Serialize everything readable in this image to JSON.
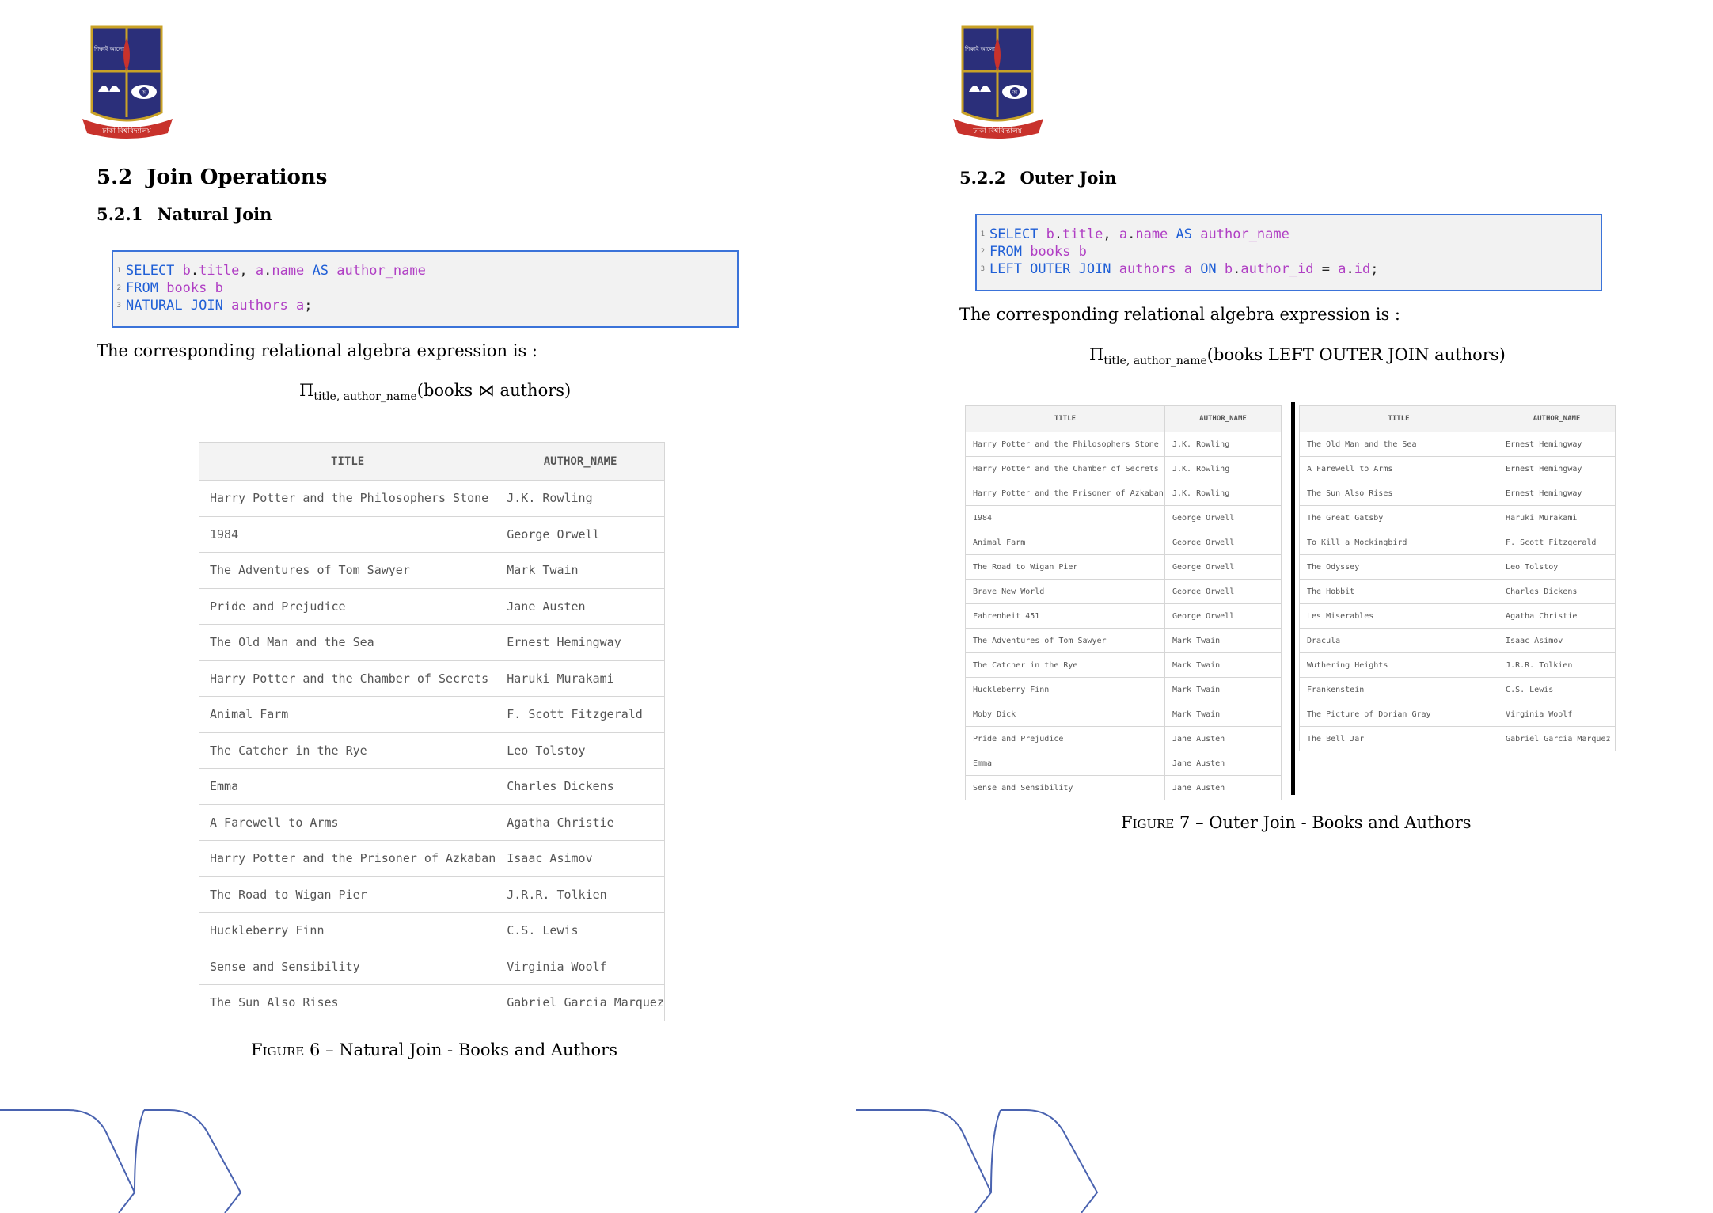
{
  "left_page": {
    "section": {
      "number": "5.2",
      "title": "Join Operations"
    },
    "subsection": {
      "number": "5.2.1",
      "title": "Natural Join"
    },
    "code": {
      "line_numbers": [
        "1",
        "2",
        "3"
      ],
      "line1": {
        "kw": "SELECT",
        "b": "b",
        "dot1": ".",
        "title": "title",
        "comma": ", ",
        "a": "a",
        "dot2": ".",
        "name": "name",
        "as": "AS",
        "alias": "author_name"
      },
      "line2": {
        "kw": "FROM",
        "table": "books",
        "alias": "b"
      },
      "line3": {
        "kw": "NATURAL JOIN",
        "table": "authors",
        "alias": "a",
        "semi": ";"
      }
    },
    "para": "The corresponding relational algebra expression is :",
    "expr": {
      "pi": "Π",
      "sub": "title, author_name",
      "body": "(books ⋈ authors)"
    },
    "table": {
      "headers": [
        "TITLE",
        "AUTHOR_NAME"
      ],
      "rows": [
        [
          "Harry Potter and the Philosophers Stone",
          "J.K. Rowling"
        ],
        [
          "1984",
          "George Orwell"
        ],
        [
          "The Adventures of Tom Sawyer",
          "Mark Twain"
        ],
        [
          "Pride and Prejudice",
          "Jane Austen"
        ],
        [
          "The Old Man and the Sea",
          "Ernest Hemingway"
        ],
        [
          "Harry Potter and the Chamber of Secrets",
          "Haruki Murakami"
        ],
        [
          "Animal Farm",
          "F. Scott Fitzgerald"
        ],
        [
          "The Catcher in the Rye",
          "Leo Tolstoy"
        ],
        [
          "Emma",
          "Charles Dickens"
        ],
        [
          "A Farewell to Arms",
          "Agatha Christie"
        ],
        [
          "Harry Potter and the Prisoner of Azkaban",
          "Isaac Asimov"
        ],
        [
          "The Road to Wigan Pier",
          "J.R.R. Tolkien"
        ],
        [
          "Huckleberry Finn",
          "C.S. Lewis"
        ],
        [
          "Sense and Sensibility",
          "Virginia Woolf"
        ],
        [
          "The Sun Also Rises",
          "Gabriel Garcia Marquez"
        ]
      ]
    },
    "caption": {
      "label": "Figure 6",
      "sep": " – ",
      "text": "Natural Join - Books and Authors"
    }
  },
  "right_page": {
    "subsection": {
      "number": "5.2.2",
      "title": "Outer Join"
    },
    "code": {
      "line_numbers": [
        "1",
        "2",
        "3"
      ],
      "line1": {
        "kw": "SELECT",
        "b": "b",
        "dot1": ".",
        "title": "title",
        "comma": ", ",
        "a": "a",
        "dot2": ".",
        "name": "name",
        "as": "AS",
        "alias": "author_name"
      },
      "line2": {
        "kw": "FROM",
        "table": "books",
        "alias": "b"
      },
      "line3": {
        "kw": "LEFT OUTER JOIN",
        "table": "authors",
        "alias": "a",
        "on": "ON",
        "b": "b",
        "dot1": ".",
        "author_id": "author_id",
        "eq": " = ",
        "a": "a",
        "dot2": ".",
        "id": "id",
        "semi": ";"
      }
    },
    "para": "The corresponding relational algebra expression is :",
    "expr": {
      "pi": "Π",
      "sub": "title, author_name",
      "body": "(books LEFT OUTER JOIN authors)"
    },
    "table_left": {
      "headers": [
        "TITLE",
        "AUTHOR_NAME"
      ],
      "rows": [
        [
          "Harry Potter and the Philosophers Stone",
          "J.K. Rowling"
        ],
        [
          "Harry Potter and the Chamber of Secrets",
          "J.K. Rowling"
        ],
        [
          "Harry Potter and the Prisoner of Azkaban",
          "J.K. Rowling"
        ],
        [
          "1984",
          "George Orwell"
        ],
        [
          "Animal Farm",
          "George Orwell"
        ],
        [
          "The Road to Wigan Pier",
          "George Orwell"
        ],
        [
          "Brave New World",
          "George Orwell"
        ],
        [
          "Fahrenheit 451",
          "George Orwell"
        ],
        [
          "The Adventures of Tom Sawyer",
          "Mark Twain"
        ],
        [
          "The Catcher in the Rye",
          "Mark Twain"
        ],
        [
          "Huckleberry Finn",
          "Mark Twain"
        ],
        [
          "Moby Dick",
          "Mark Twain"
        ],
        [
          "Pride and Prejudice",
          "Jane Austen"
        ],
        [
          "Emma",
          "Jane Austen"
        ],
        [
          "Sense and Sensibility",
          "Jane Austen"
        ]
      ]
    },
    "table_right": {
      "headers": [
        "TITLE",
        "AUTHOR_NAME"
      ],
      "rows": [
        [
          "The Old Man and the Sea",
          "Ernest Hemingway"
        ],
        [
          "A Farewell to Arms",
          "Ernest Hemingway"
        ],
        [
          "The Sun Also Rises",
          "Ernest Hemingway"
        ],
        [
          "The Great Gatsby",
          "Haruki Murakami"
        ],
        [
          "To Kill a Mockingbird",
          "F. Scott Fitzgerald"
        ],
        [
          "The Odyssey",
          "Leo Tolstoy"
        ],
        [
          "The Hobbit",
          "Charles Dickens"
        ],
        [
          "Les Miserables",
          "Agatha Christie"
        ],
        [
          "Dracula",
          "Isaac Asimov"
        ],
        [
          "Wuthering Heights",
          "J.R.R. Tolkien"
        ],
        [
          "Frankenstein",
          "C.S. Lewis"
        ],
        [
          "The Picture of Dorian Gray",
          "Virginia Woolf"
        ],
        [
          "The Bell Jar",
          "Gabriel Garcia Marquez"
        ]
      ]
    },
    "caption": {
      "label": "Figure 7",
      "sep": " – ",
      "text": "Outer Join - Books and Authors"
    }
  },
  "logo": {
    "icon": "university-crest-icon",
    "text": "ঢাকা বিশ্ববিদ্যালয়",
    "top_text": "শিক্ষাই আলো",
    "emblem": "অ"
  },
  "colors": {
    "code_border": "#3b73d9",
    "keyword": "#1f5fd6",
    "identifier": "#b03fc4",
    "code_bg": "#f2f2f2",
    "crest_blue": "#2b2f7a",
    "crest_red": "#c8322c",
    "deco_line": "#4a63b0"
  }
}
